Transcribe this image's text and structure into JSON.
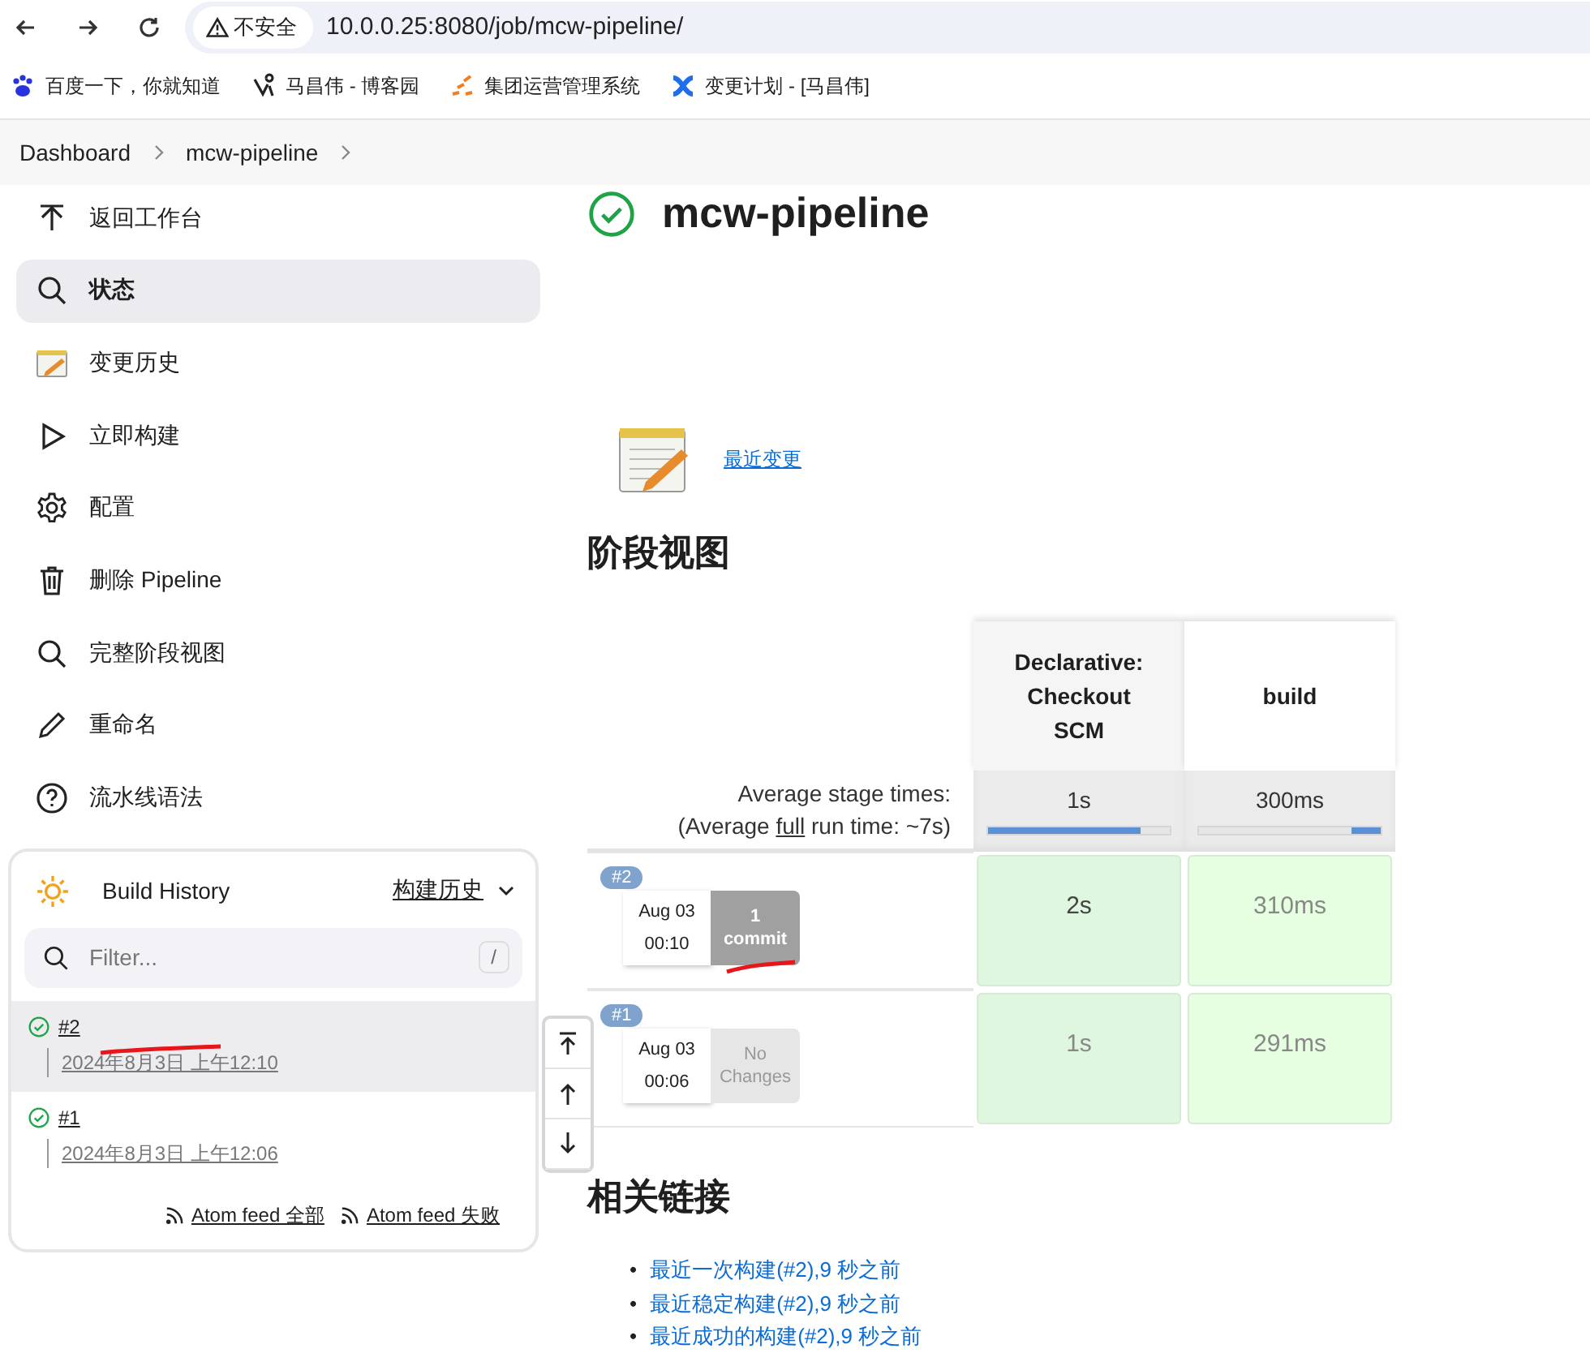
{
  "browser": {
    "security": "不安全",
    "url": "10.0.0.25:8080/job/mcw-pipeline/",
    "bookmarks": [
      {
        "kind": "paw",
        "label": "百度一下，你就知道"
      },
      {
        "kind": "figure",
        "label": "马昌伟 - 博客园"
      },
      {
        "kind": "dashes",
        "label": "集团运营管理系统"
      },
      {
        "kind": "cross",
        "label": "变更计划 - [马昌伟]"
      }
    ]
  },
  "breadcrumb": [
    "Dashboard",
    "mcw-pipeline"
  ],
  "sidebar": {
    "items": [
      {
        "kind": "up",
        "label": "返回工作台",
        "selected": false
      },
      {
        "kind": "search",
        "label": "状态",
        "selected": true
      },
      {
        "kind": "notepad",
        "label": "变更历史",
        "selected": false
      },
      {
        "kind": "play",
        "label": "立即构建",
        "selected": false
      },
      {
        "kind": "gear",
        "label": "配置",
        "selected": false
      },
      {
        "kind": "trash",
        "label": "删除 Pipeline",
        "selected": false
      },
      {
        "kind": "search",
        "label": "完整阶段视图",
        "selected": false
      },
      {
        "kind": "pencil",
        "label": "重命名",
        "selected": false
      },
      {
        "kind": "help",
        "label": "流水线语法",
        "selected": false
      }
    ]
  },
  "build_history": {
    "title": "Build History",
    "link": "构建历史",
    "filter": {
      "placeholder": "Filter...",
      "shortcut": "/"
    },
    "builds": [
      {
        "number": "#2",
        "time": "2024年8月3日 上午12:10",
        "selected": true
      },
      {
        "number": "#1",
        "time": "2024年8月3日 上午12:06",
        "selected": false
      }
    ],
    "feeds": [
      "Atom feed 全部",
      "Atom feed 失败"
    ]
  },
  "job": {
    "title": "mcw-pipeline",
    "recent_changes": "最近变更"
  },
  "stage_view": {
    "heading": "阶段视图",
    "avg_label": "Average stage times:",
    "full_prefix": "(Average ",
    "full_link": "full",
    "full_suffix": " run time: ~7s)",
    "stages": [
      {
        "name": "Declarative: Checkout SCM",
        "avg": "1s",
        "level": 0.84,
        "kind": "lead"
      },
      {
        "name": "build",
        "avg": "300ms",
        "level": 0.16,
        "kind": "tail"
      }
    ],
    "runs": [
      {
        "number": "#2",
        "date": "Aug 03",
        "time": "00:10",
        "kind": "commits",
        "changes": [
          "1",
          "commit"
        ],
        "times": [
          "2s",
          "310ms"
        ]
      },
      {
        "number": "#1",
        "date": "Aug 03",
        "time": "00:06",
        "kind": "none",
        "changes": [
          "No",
          "Changes"
        ],
        "times": [
          "1s",
          "291ms"
        ]
      }
    ]
  },
  "related": {
    "heading": "相关链接",
    "links": [
      {
        "bullet": "•",
        "label": "最近一次构建(#2),9 秒之前"
      },
      {
        "bullet": "•",
        "label": "最近稳定构建(#2),9 秒之前"
      },
      {
        "bullet": "•",
        "label": "最近成功的构建(#2),9 秒之前"
      }
    ]
  }
}
